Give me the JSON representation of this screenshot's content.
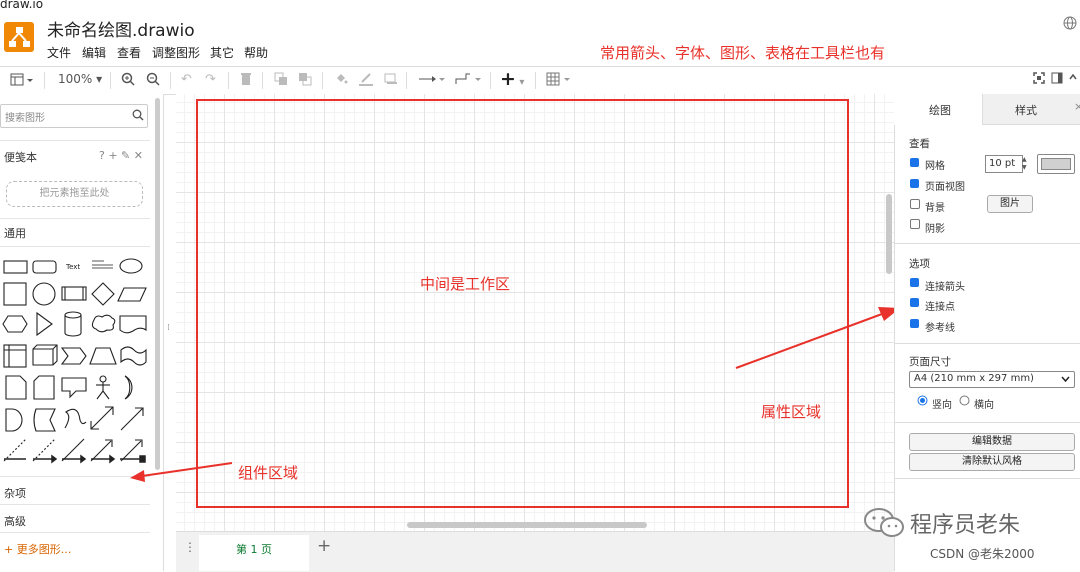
{
  "window": {
    "url_fragment": "draw.io",
    "title": "未命名绘图.drawio"
  },
  "menu": [
    "文件",
    "编辑",
    "查看",
    "调整图形",
    "其它",
    "帮助"
  ],
  "toolbar": {
    "zoom": "100%",
    "insert_label": "+"
  },
  "left_panel": {
    "search_placeholder": "搜索图形",
    "scratchpad_title": "便笺本",
    "scratchpad_tools": "? + ✎ ✕",
    "scratchpad_drop": "把元素拖至此处",
    "general_title": "通用",
    "shape_text": "Text",
    "misc": "杂项",
    "advanced": "高级",
    "more_shapes": "+ 更多图形..."
  },
  "annotations": {
    "toolbar_note": "常用箭头、字体、图形、表格在工具栏也有",
    "workspace": "中间是工作区",
    "components": "组件区域",
    "properties": "属性区域"
  },
  "bottom": {
    "page_tab": "第 1 页",
    "add_page": "+"
  },
  "right_panel": {
    "tabs": [
      "绘图",
      "样式"
    ],
    "view_section": "查看",
    "grid_label": "网格",
    "grid_size": "10 pt",
    "page_view": "页面视图",
    "background": "背景",
    "image_button": "图片",
    "shadow": "阴影",
    "options_section": "选项",
    "connection_arrows": "连接箭头",
    "connection_points": "连接点",
    "guides": "参考线",
    "page_size_section": "页面尺寸",
    "paper_size": "A4 (210 mm x 297 mm)",
    "portrait": "竖向",
    "landscape": "横向",
    "edit_data": "编辑数据",
    "clear_style": "清除默认风格"
  },
  "watermark": {
    "wechat": "程序员老朱",
    "csdn": "CSDN @老朱2000"
  },
  "colors": {
    "accent": "#e8312a",
    "logo": "#f08705",
    "checkbox": "#1a73e8"
  }
}
